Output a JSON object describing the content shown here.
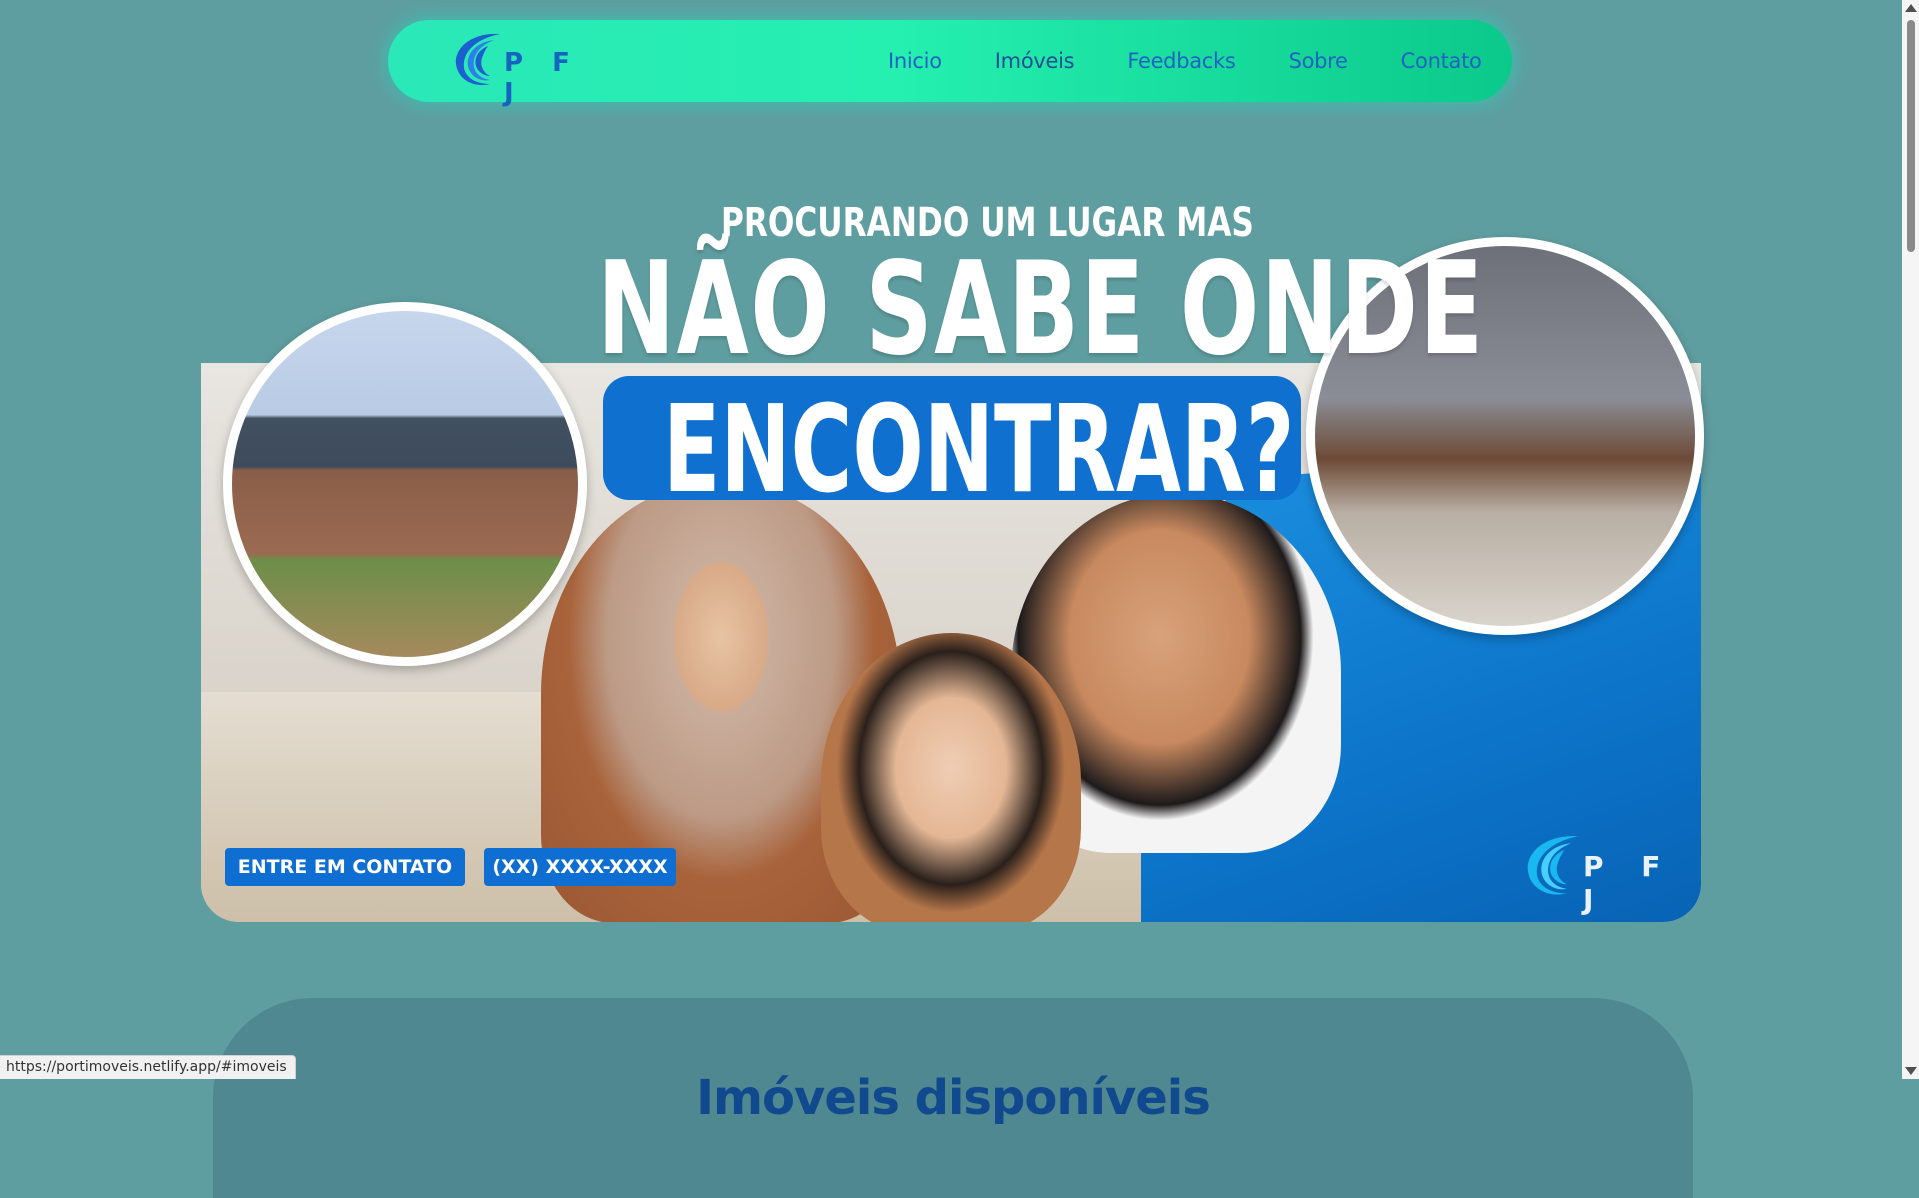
{
  "navbar": {
    "logo_text": "P F J",
    "links": [
      {
        "label": "Inicio"
      },
      {
        "label": "Imóveis"
      },
      {
        "label": "Feedbacks"
      },
      {
        "label": "Sobre"
      },
      {
        "label": "Contato"
      }
    ]
  },
  "hero": {
    "headline_small": "PROCURANDO UM LUGAR MAS",
    "headline_big": "NÃO SABE ONDE",
    "headline_highlight": "ENCONTRAR?",
    "contact_button": "ENTRE EM CONTATO",
    "phone_button": "(XX) XXXX-XXXX",
    "logo_text": "P F J"
  },
  "section": {
    "title": "Imóveis disponíveis"
  },
  "status_bar": {
    "url": "https://portimoveis.netlify.app/#imoveis"
  },
  "colors": {
    "background": "#5f9ea0",
    "nav_gradient_start": "#2ae8b8",
    "nav_gradient_end": "#0bc98a",
    "nav_link": "#1f62c4",
    "brand_blue": "#0f70d0"
  }
}
